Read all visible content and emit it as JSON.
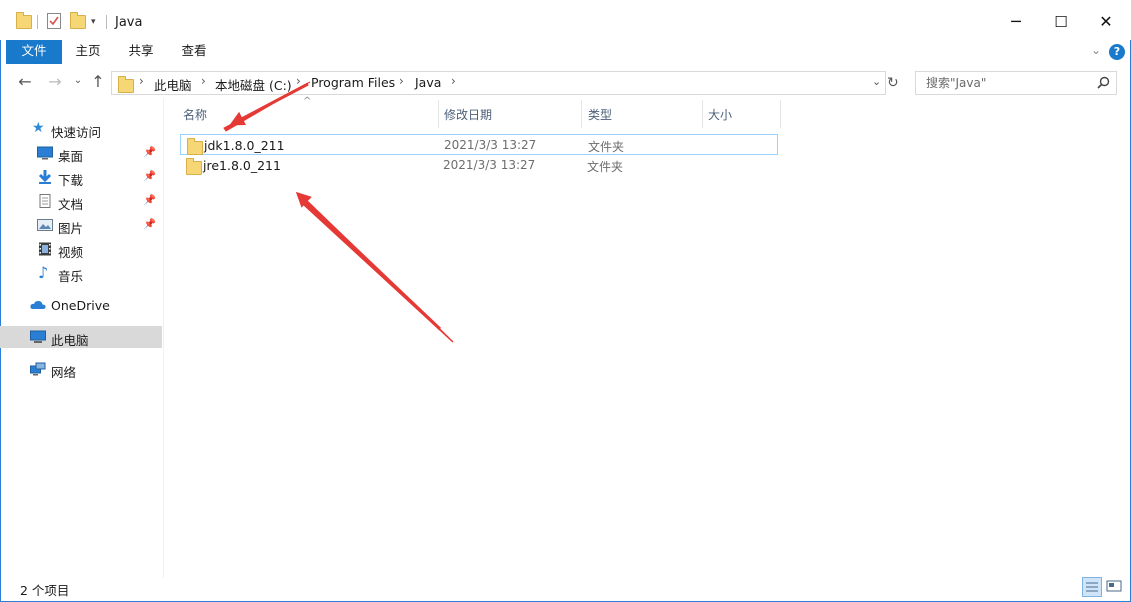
{
  "window": {
    "title": "Java",
    "minimize": "─",
    "maximize": "☐",
    "close": "✕"
  },
  "ribbon": {
    "tabs": [
      "文件",
      "主页",
      "共享",
      "查看"
    ],
    "help": "?"
  },
  "address": {
    "crumbs": [
      "此电脑",
      "本地磁盘 (C:)",
      "Program Files",
      "Java"
    ],
    "search_placeholder": "搜索\"Java\""
  },
  "nav": {
    "quick_access": "快速访问",
    "items": [
      {
        "label": "桌面",
        "icon": "desktop-icon",
        "pinned": true
      },
      {
        "label": "下载",
        "icon": "download-icon",
        "pinned": true
      },
      {
        "label": "文档",
        "icon": "document-icon",
        "pinned": true
      },
      {
        "label": "图片",
        "icon": "picture-icon",
        "pinned": true
      },
      {
        "label": "视频",
        "icon": "video-icon",
        "pinned": false
      },
      {
        "label": "音乐",
        "icon": "music-icon",
        "pinned": false
      }
    ],
    "onedrive": "OneDrive",
    "this_pc": "此电脑",
    "network": "网络"
  },
  "columns": {
    "name": "名称",
    "date": "修改日期",
    "type": "类型",
    "size": "大小"
  },
  "files": [
    {
      "name": "jdk1.8.0_211",
      "date": "2021/3/3 13:27",
      "type": "文件夹",
      "size": ""
    },
    {
      "name": "jre1.8.0_211",
      "date": "2021/3/3 13:27",
      "type": "文件夹",
      "size": ""
    }
  ],
  "status": {
    "count": "2 个项目"
  },
  "colors": {
    "accent": "#1979ca",
    "annotation_arrow": "#e53935",
    "selection_border": "#99d1ff"
  }
}
